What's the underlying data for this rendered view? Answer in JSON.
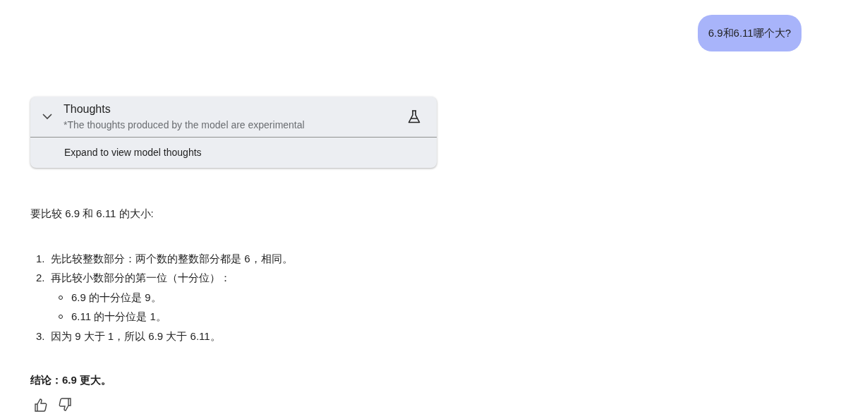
{
  "user_message": "6.9和6.11哪个大?",
  "thoughts": {
    "title": "Thoughts",
    "note": "*The thoughts produced by the model are experimental",
    "expanded": false,
    "expand_label": "Expand to view model thoughts"
  },
  "answer": {
    "intro": "要比较 6.9 和 6.11 的大小:",
    "steps": [
      {
        "marker": "1.",
        "text": "先比较整数部分：两个数的整数部分都是 6，相同。"
      },
      {
        "marker": "2.",
        "text": "再比较小数部分的第一位（十分位）：",
        "children": [
          {
            "text": "6.9 的十分位是 9。"
          },
          {
            "text": "6.11 的十分位是 1。"
          }
        ]
      },
      {
        "marker": "3.",
        "text": "因为 9 大于 1，所以 6.9 大于 6.11。"
      }
    ],
    "conclusion": "结论：6.9 更大。"
  }
}
